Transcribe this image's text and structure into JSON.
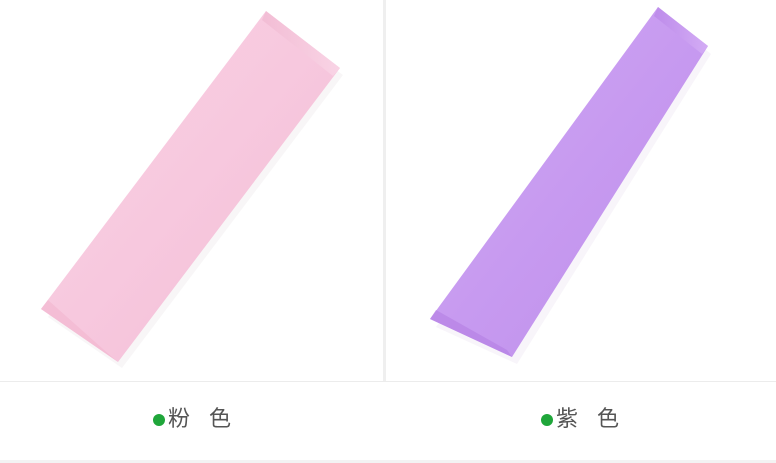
{
  "products": [
    {
      "caption": "粉 色",
      "swatch_color": "#f7c9df",
      "dot_color": "#1fa63a",
      "image_icon": "pink-headband-image"
    },
    {
      "caption": "紫 色",
      "swatch_color": "#c99cf0",
      "dot_color": "#1fa63a",
      "image_icon": "purple-headband-image"
    }
  ]
}
